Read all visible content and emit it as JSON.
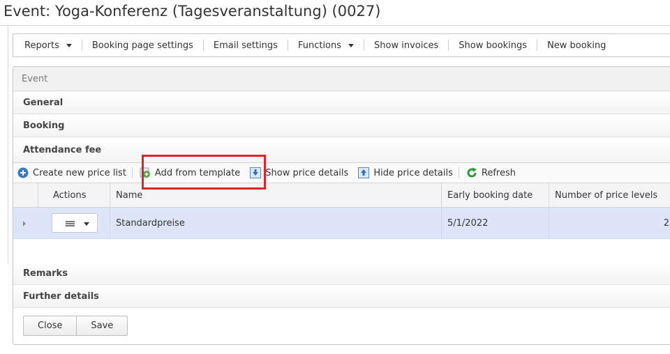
{
  "window": {
    "title": "Event: Yoga-Konferenz (Tagesveranstaltung) (0027)"
  },
  "toolbar": {
    "reports": "Reports",
    "booking_page_settings": "Booking page settings",
    "email_settings": "Email settings",
    "functions": "Functions",
    "show_invoices": "Show invoices",
    "show_bookings": "Show bookings",
    "new_booking": "New booking"
  },
  "panel": {
    "header": "Event",
    "sections": {
      "general": "General",
      "booking": "Booking",
      "attendance_fee": "Attendance fee",
      "remarks": "Remarks",
      "further_details": "Further details"
    }
  },
  "price_toolbar": {
    "create": "Create new price list",
    "add_template": "Add from template",
    "show_details": "Show price details",
    "hide_details": "Hide price details",
    "refresh": "Refresh"
  },
  "grid": {
    "columns": [
      "Actions",
      "Name",
      "Early booking date",
      "Number of price levels"
    ],
    "rows": [
      {
        "name": "Standardpreise",
        "early_booking_date": "5/1/2022",
        "price_levels": "2"
      }
    ]
  },
  "buttons": {
    "close": "Close",
    "save": "Save"
  },
  "colors": {
    "highlight": "#e0222b",
    "selected_row": "#dce6f8",
    "refresh_green": "#2e9b2e",
    "create_blue": "#3a78c9"
  },
  "icons": [
    "plus-circle-icon",
    "add-template-icon",
    "show-details-icon",
    "hide-details-icon",
    "refresh-icon",
    "menu-icon",
    "chevron-down-icon",
    "expand-arrow-icon"
  ]
}
